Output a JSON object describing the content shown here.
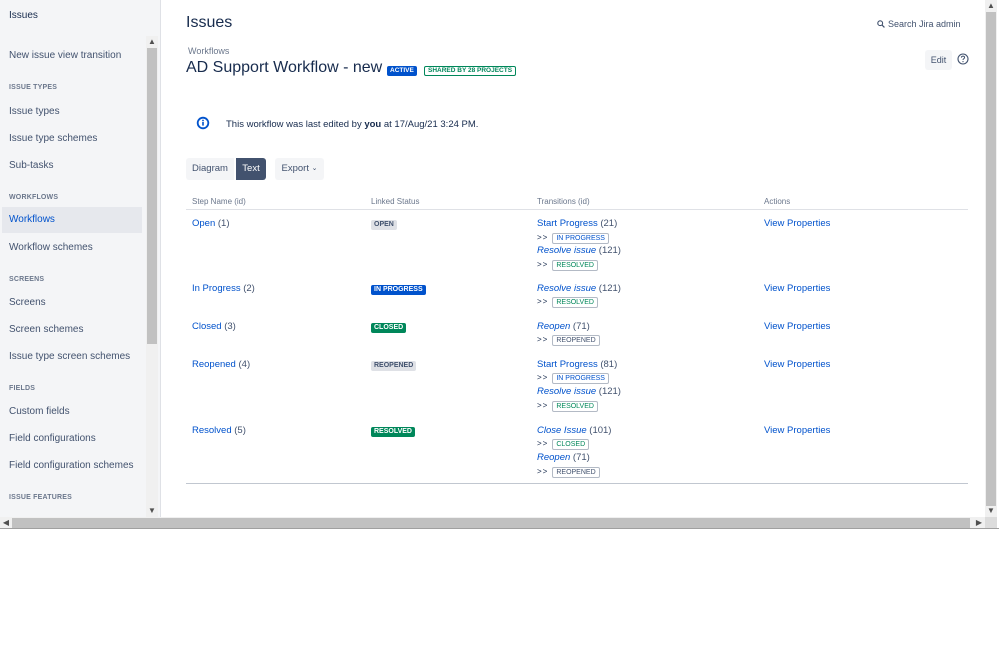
{
  "sidebar": {
    "title": "Issues",
    "transition_item": "New issue view transition",
    "sections": [
      {
        "heading": "ISSUE TYPES",
        "items": [
          "Issue types",
          "Issue type schemes",
          "Sub-tasks"
        ]
      },
      {
        "heading": "WORKFLOWS",
        "items": [
          "Workflows",
          "Workflow schemes"
        ]
      },
      {
        "heading": "SCREENS",
        "items": [
          "Screens",
          "Screen schemes",
          "Issue type screen schemes"
        ]
      },
      {
        "heading": "FIELDS",
        "items": [
          "Custom fields",
          "Field configurations",
          "Field configuration schemes"
        ]
      },
      {
        "heading": "ISSUE FEATURES",
        "items": []
      }
    ],
    "active_item": "Workflows"
  },
  "header": {
    "title": "Issues",
    "search_label": "Search Jira admin"
  },
  "workflow": {
    "breadcrumb": "Workflows",
    "name": "AD Support Workflow - new",
    "status_badge": "ACTIVE",
    "shared_badge": "SHARED BY 28 PROJECTS",
    "edit_label": "Edit",
    "info_prefix": "This workflow was last edited by",
    "info_user": "you",
    "info_suffix": "at 17/Aug/21 3:24 PM."
  },
  "view_buttons": {
    "diagram": "Diagram",
    "text": "Text",
    "export": "Export"
  },
  "table": {
    "headers": [
      "Step Name (id)",
      "Linked Status",
      "Transitions (id)",
      "Actions"
    ],
    "rows": [
      {
        "step": "Open",
        "step_id": "(1)",
        "status": "OPEN",
        "status_color": "grey",
        "transitions": [
          {
            "name": "Start Progress",
            "id": "(21)",
            "italic": false,
            "target": "IN PROGRESS",
            "target_color": "blue"
          },
          {
            "name": "Resolve issue",
            "id": "(121)",
            "italic": true,
            "target": "RESOLVED",
            "target_color": "green"
          }
        ],
        "action": "View Properties"
      },
      {
        "step": "In Progress",
        "step_id": "(2)",
        "status": "IN PROGRESS",
        "status_color": "blue",
        "transitions": [
          {
            "name": "Resolve issue",
            "id": "(121)",
            "italic": true,
            "target": "RESOLVED",
            "target_color": "green"
          }
        ],
        "action": "View Properties"
      },
      {
        "step": "Closed",
        "step_id": "(3)",
        "status": "CLOSED",
        "status_color": "green",
        "transitions": [
          {
            "name": "Reopen",
            "id": "(71)",
            "italic": true,
            "target": "REOPENED",
            "target_color": "grey"
          }
        ],
        "action": "View Properties"
      },
      {
        "step": "Reopened",
        "step_id": "(4)",
        "status": "REOPENED",
        "status_color": "grey",
        "transitions": [
          {
            "name": "Start Progress",
            "id": "(81)",
            "italic": false,
            "target": "IN PROGRESS",
            "target_color": "blue"
          },
          {
            "name": "Resolve issue",
            "id": "(121)",
            "italic": true,
            "target": "RESOLVED",
            "target_color": "green"
          }
        ],
        "action": "View Properties"
      },
      {
        "step": "Resolved",
        "step_id": "(5)",
        "status": "RESOLVED",
        "status_color": "green",
        "transitions": [
          {
            "name": "Close Issue",
            "id": "(101)",
            "italic": true,
            "target": "CLOSED",
            "target_color": "green"
          },
          {
            "name": "Reopen",
            "id": "(71)",
            "italic": true,
            "target": "REOPENED",
            "target_color": "grey"
          }
        ],
        "action": "View Properties"
      }
    ]
  },
  "colors": {
    "link": "#0052cc",
    "active_badge": "#0052cc",
    "success": "#00875a",
    "sidebar_bg": "#f4f5f7"
  }
}
